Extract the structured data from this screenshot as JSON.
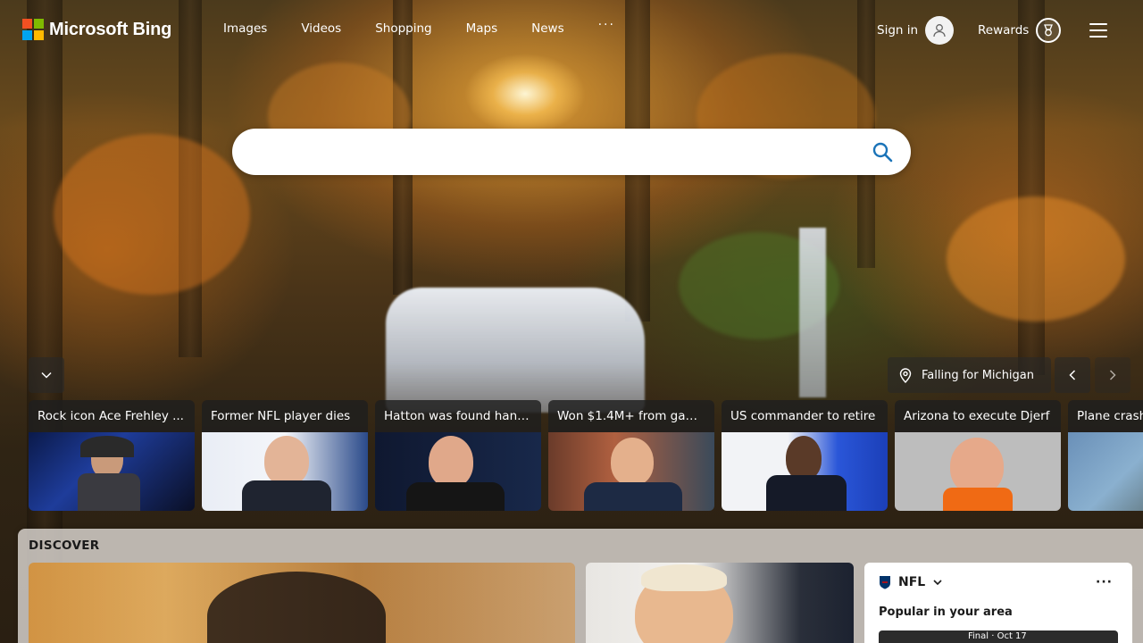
{
  "brand": {
    "name": "Microsoft Bing"
  },
  "nav": {
    "items": [
      "Images",
      "Videos",
      "Shopping",
      "Maps",
      "News"
    ],
    "more_label": "···"
  },
  "account": {
    "signin_label": "Sign in",
    "rewards_label": "Rewards"
  },
  "search": {
    "value": "",
    "placeholder": ""
  },
  "image_of_day": {
    "location_label": "Falling for Michigan"
  },
  "news_tiles": [
    {
      "title": "Rock icon Ace Frehley ..."
    },
    {
      "title": "Former NFL player dies"
    },
    {
      "title": "Hatton was found hang..."
    },
    {
      "title": "Won $1.4M+ from gam..."
    },
    {
      "title": "US commander to retire"
    },
    {
      "title": "Arizona to execute Djerf"
    },
    {
      "title": "Plane crash"
    }
  ],
  "discover": {
    "heading": "DISCOVER",
    "nfl_card": {
      "league": "NFL",
      "subtitle": "Popular in your area",
      "score_status": "Final · Oct 17"
    }
  },
  "colors": {
    "ms_red": "#f25022",
    "ms_green": "#7fba00",
    "ms_blue": "#00a4ef",
    "ms_yellow": "#ffb900",
    "search_icon": "#1a73b8"
  }
}
